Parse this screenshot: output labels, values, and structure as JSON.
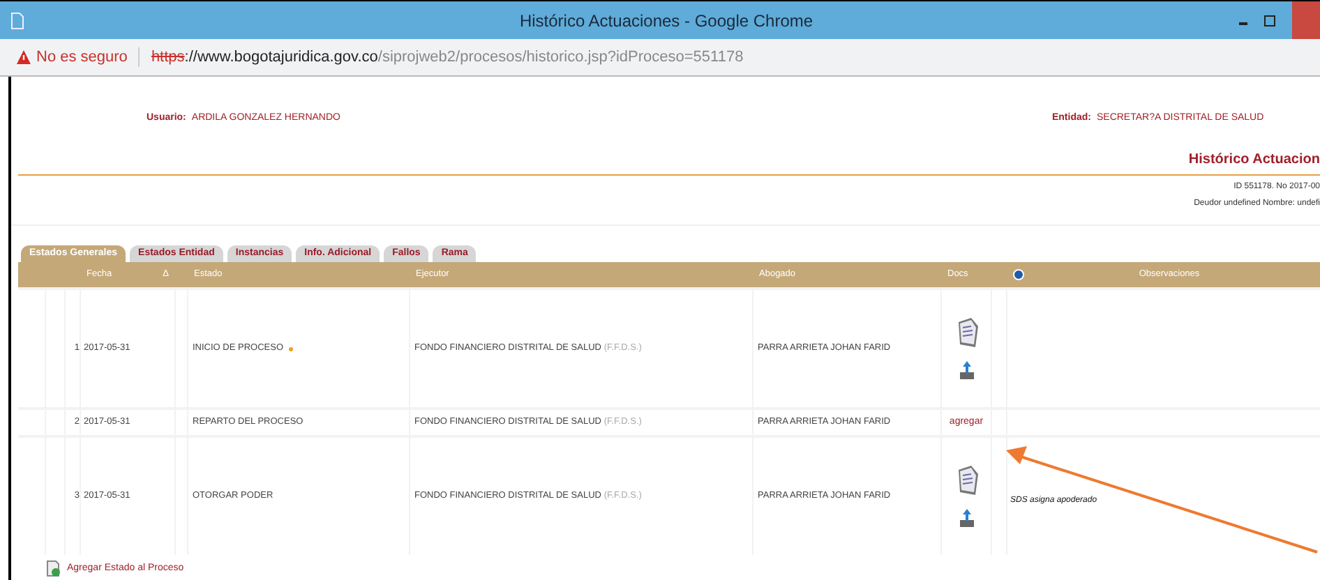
{
  "window": {
    "title": "Histórico Actuaciones - Google Chrome"
  },
  "address_bar": {
    "security": "No es seguro",
    "scheme": "https",
    "host": "://www.bogotajuridica.gov.co",
    "path": "/siprojweb2/procesos/historico.jsp?idProceso=551178"
  },
  "header": {
    "user_label": "Usuario:",
    "user": "ARDILA GONZALEZ HERNANDO",
    "entity_label": "Entidad:",
    "entity": "SECRETAR?A DISTRITAL DE SALUD",
    "title": "Histórico Actuacion",
    "id_line": "ID 551178. No 2017-00",
    "debtor_line": "Deudor undefined Nombre: undefi"
  },
  "tabs": [
    {
      "label": "Estados Generales",
      "selected": true
    },
    {
      "label": "Estados Entidad",
      "selected": false
    },
    {
      "label": "Instancias",
      "selected": false
    },
    {
      "label": "Info. Adicional",
      "selected": false
    },
    {
      "label": "Fallos",
      "selected": false
    },
    {
      "label": "Rama",
      "selected": false
    }
  ],
  "table": {
    "columns": {
      "fecha": "Fecha",
      "sort": "Δ",
      "estado": "Estado",
      "ejecutor": "Ejecutor",
      "abogado": "Abogado",
      "docs": "Docs",
      "observaciones": "Observaciones"
    },
    "rows": [
      {
        "number": "1",
        "fecha": "2017-05-31",
        "estado": "INICIO DE PROCESO",
        "marked": true,
        "ejecutor": "FONDO FINANCIERO DISTRITAL DE SALUD",
        "sigla": "(F.F.D.S.)",
        "abogado": "PARRA ARRIETA JOHAN FARID",
        "docs": {
          "kind": "icons"
        }
      },
      {
        "number": "2",
        "fecha": "2017-05-31",
        "estado": "REPARTO DEL PROCESO",
        "marked": false,
        "ejecutor": "FONDO FINANCIERO DISTRITAL DE SALUD",
        "sigla": "(F.F.D.S.)",
        "abogado": "PARRA ARRIETA JOHAN FARID",
        "docs": {
          "kind": "link",
          "label": "agregar"
        }
      },
      {
        "number": "3",
        "fecha": "2017-05-31",
        "estado": "OTORGAR PODER",
        "marked": false,
        "ejecutor": "FONDO FINANCIERO DISTRITAL DE SALUD",
        "sigla": "(F.F.D.S.)",
        "abogado": "PARRA ARRIETA JOHAN FARID",
        "docs": {
          "kind": "icons"
        },
        "observaciones": "SDS asigna apoderado"
      }
    ]
  },
  "add_link": "Agregar Estado al Proceso"
}
